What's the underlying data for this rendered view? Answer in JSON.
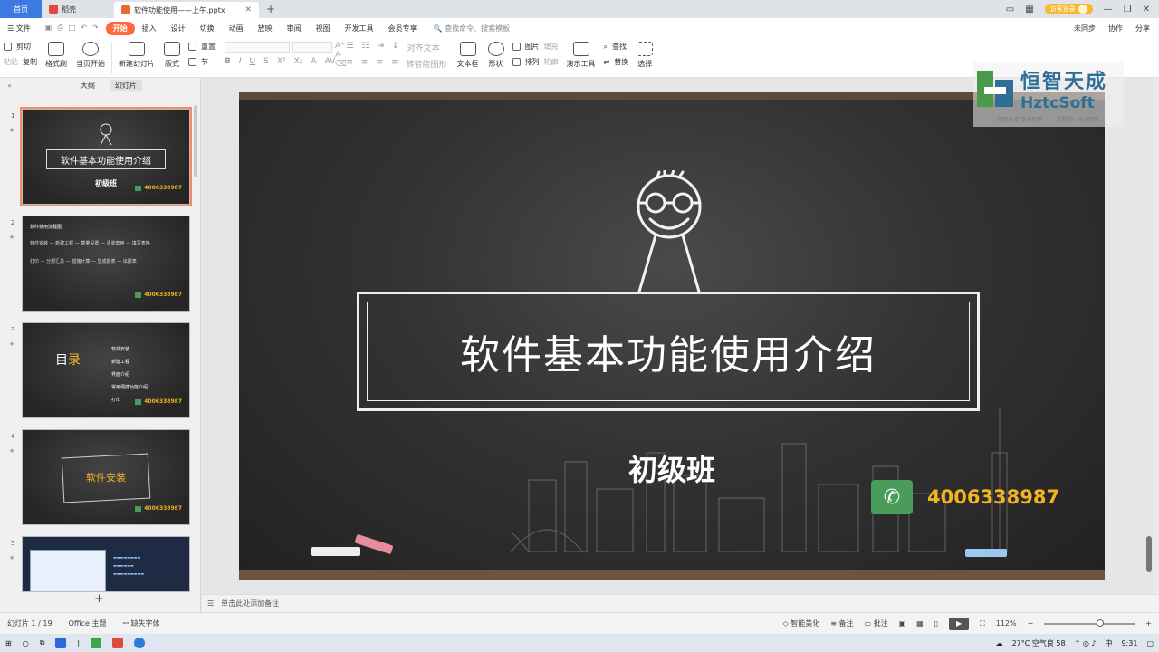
{
  "tabs": {
    "home": "首页",
    "daoke": "稻壳",
    "document": "软件功能使用——上午.pptx",
    "new_tab": "+"
  },
  "top_right": {
    "visitor": "访客登录"
  },
  "menu": {
    "file": "文件",
    "items": [
      "开始",
      "插入",
      "设计",
      "切换",
      "动画",
      "放映",
      "审阅",
      "视图",
      "开发工具",
      "会员专享"
    ],
    "search": "查找命令、搜索模板",
    "sync": "未同步",
    "collab": "协作",
    "share": "分享"
  },
  "ribbon": {
    "cut": "剪切",
    "paste": "粘贴",
    "copy": "复制",
    "format_painter": "格式刷",
    "from_current": "当页开始",
    "new_slide": "新建幻灯片",
    "layout": "版式",
    "reset": "重置",
    "section": "节",
    "text_box": "文本框",
    "shape": "形状",
    "picture": "图片",
    "arrange": "排列",
    "fill": "填充",
    "outline": "轮廓",
    "present_tools": "演示工具",
    "find": "查找",
    "replace": "替换",
    "select": "选择",
    "align_text": "对齐文本",
    "to_smartart": "转智能图形"
  },
  "panel": {
    "outline_tab": "大纲",
    "slides_tab": "幻灯片",
    "collapse": "«",
    "add": "+"
  },
  "thumbnails": [
    {
      "num": "1",
      "title": "软件基本功能使用介绍",
      "sub": "初级班",
      "phone": "4006338987"
    },
    {
      "num": "2",
      "head": "软件使用流程图",
      "row1": "软件安装 — 新建工程 — 算量设置 — 清单套用 — 填写表格",
      "row2": "打印 — 分部汇总 — 措施计算 — 生成报表 — 出报表",
      "phone": "4006338987"
    },
    {
      "num": "3",
      "mu1": "目",
      "mu2": "录",
      "list": [
        "软件安装",
        "新建工程",
        "界面介绍",
        "常用便捷功能介绍",
        "打印"
      ],
      "phone": "4006338987"
    },
    {
      "num": "4",
      "title": "软件安装",
      "phone": "4006338987"
    },
    {
      "num": "5"
    }
  ],
  "slide": {
    "title": "软件基本功能使用介绍",
    "subtitle": "初级班",
    "phone": "4006338987"
  },
  "watermark": {
    "cn": "恒智天成",
    "en": "HztcSoft",
    "tag": "恒智天成 专业软件 —— 工程师 · 专业团队"
  },
  "notes": {
    "placeholder": "单击此处添加备注"
  },
  "status": {
    "slide_counter": "幻灯片 1 / 19",
    "theme": "Office 主题",
    "missing_font": "缺失字体",
    "beautify": "智能美化",
    "notes": "备注",
    "comments": "批注",
    "zoom": "112%"
  },
  "taskbar": {
    "weather": "27°C 空气良 58",
    "lang": "中",
    "time": "9:31"
  }
}
